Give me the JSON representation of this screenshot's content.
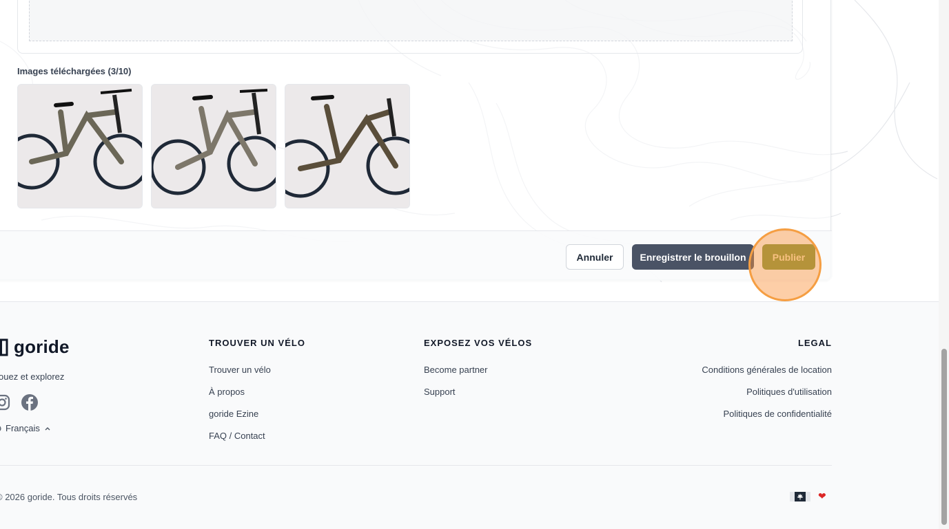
{
  "form": {
    "images_heading": "Images téléchargées (3/10)",
    "images": [
      {
        "name": "bike-photo-1"
      },
      {
        "name": "bike-photo-2"
      },
      {
        "name": "bike-photo-3"
      }
    ],
    "buttons": {
      "cancel": "Annuler",
      "save_draft": "Enregistrer le brouillon",
      "publish": "Publier"
    }
  },
  "footer": {
    "brand": "goride",
    "tagline": "ouez et explorez",
    "social_icons": [
      "instagram-icon",
      "facebook-icon"
    ],
    "language": "Français",
    "columns": {
      "find": {
        "title": "TROUVER UN VÉLO",
        "links": [
          "Trouver un vélo",
          "À propos",
          "goride Ezine",
          "FAQ / Contact"
        ]
      },
      "expose": {
        "title": "EXPOSEZ VOS VÉLOS",
        "links": [
          "Become partner",
          "Support"
        ]
      },
      "legal": {
        "title": "LEGAL",
        "links": [
          "Conditions générales de location",
          "Politiques d'utilisation",
          "Politiques de confidentialité"
        ]
      }
    },
    "copyright": "© 2026 goride. Tous droits réservés",
    "flag_icon": "canada-flag-icon",
    "heart_icon": "heart-icon"
  },
  "colors": {
    "publish": "#7c943a",
    "draft": "#4a5365",
    "highlight": "#f59e42"
  }
}
